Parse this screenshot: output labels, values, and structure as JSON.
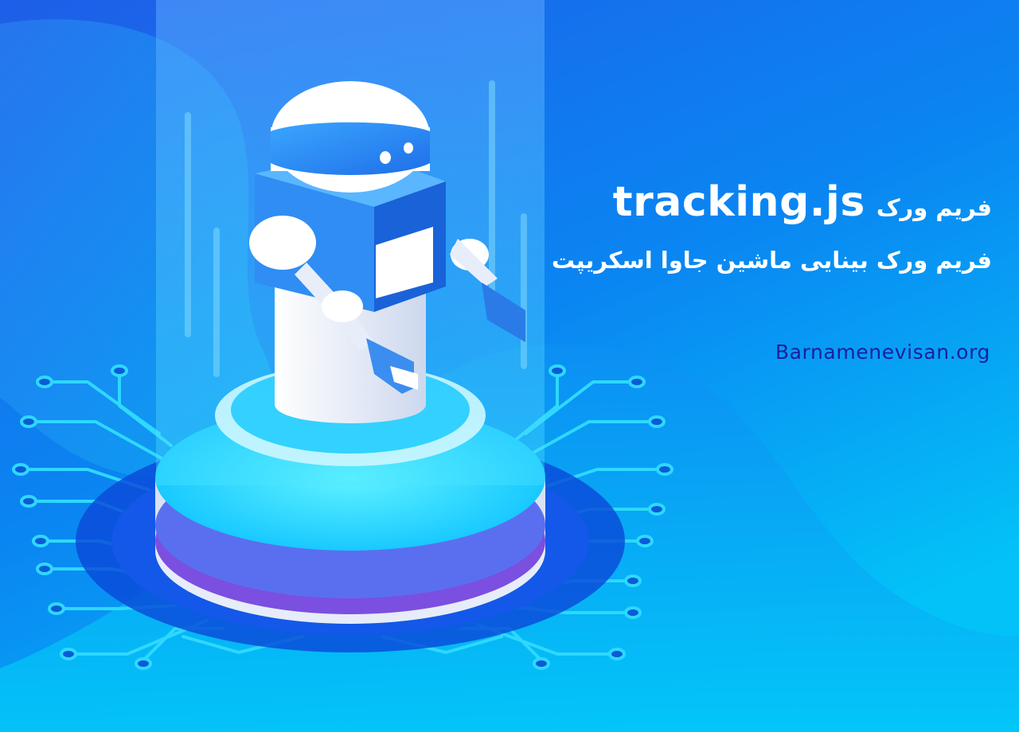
{
  "text": {
    "headline_latin": "tracking.js",
    "headline_fa": "فریم ورک",
    "subtitle": "فریم ورک بینایی ماشین جاوا اسکریپت",
    "site": "Barnamenevisan.org"
  },
  "colors": {
    "bg_top": "#1a63e6",
    "bg_bottom": "#02bff5",
    "title_white": "#ffffff",
    "site_navy": "#1b1f9e",
    "cyan": "#28e4ff",
    "deep_blue": "#0a3fd0"
  },
  "icons": [
    "robot-illustration",
    "circuit-board-lines",
    "pedestal-platform",
    "light-beam"
  ]
}
